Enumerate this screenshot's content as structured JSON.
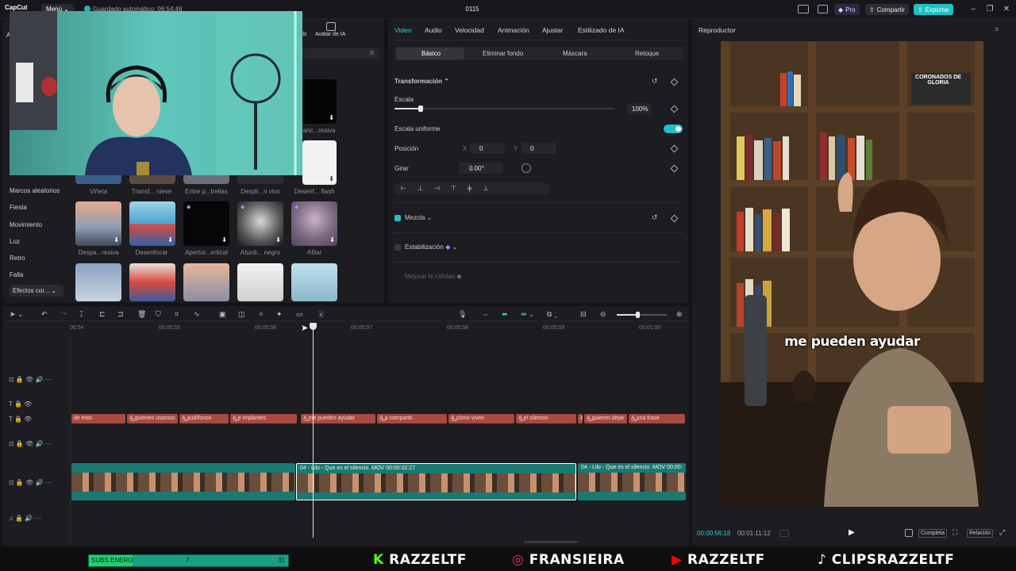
{
  "topbar": {
    "logo": "CapCut",
    "menu": "Menú",
    "autosave": "Guardado automático: 06:54:46",
    "project_title": "0115",
    "pro": "Pro",
    "share": "Compartir",
    "export": "Exportar"
  },
  "left": {
    "tabs": [
      "fils",
      "Avatar de IA"
    ],
    "categories": [
      "Marcos aleatorios",
      "Fiesta",
      "Movimiento",
      "Luz",
      "Retro",
      "Falla",
      "Efectos cor..."
    ],
    "effects_row1": [
      "Viñeta",
      "Transf... nieve",
      "Entre p...trellas",
      "Despli...n vivo",
      "Desenf... flash"
    ],
    "effects_row2": [
      "Despa...resiva",
      "Desenfocar",
      "Apertur...ertical",
      "Aturdi... negro",
      "Afilar"
    ],
    "right_label": "aric...resiva"
  },
  "inspector": {
    "tabs": [
      "Video",
      "Audio",
      "Velocidad",
      "Animación",
      "Ajustar",
      "Estilizado de IA"
    ],
    "subtabs": [
      "Básico",
      "Eliminar fondo",
      "Máscara",
      "Retoque"
    ],
    "transform": "Transformación",
    "scale_label": "Escala",
    "scale_value": "100%",
    "scale_fraction": 0.12,
    "uniform_label": "Escala uniforme",
    "position_label": "Posición",
    "pos_x_label": "X",
    "pos_x": "0",
    "pos_y_label": "Y",
    "pos_y": "0",
    "rotate_label": "Girar",
    "rotate_value": "0.00°",
    "blend": "Mezcla",
    "stabilize": "Estabilización",
    "quality": "Mejorar la calidad"
  },
  "timeline": {
    "ruler": [
      "00:54",
      "00:00:55",
      "00:00:56",
      "00:00:57",
      "00:00:58",
      "00:00:59",
      "00:01:00"
    ],
    "subtitles": [
      "de esto",
      "quienes usamos",
      "audífonos",
      "e implantes",
      "me pueden ayudar",
      "a compartir",
      "cómo viven",
      "el silencio",
      "A",
      "quieren dejar",
      "una frase"
    ],
    "clip_label": "04 - Lilo - Que es el silencio .MOV  00:00:02:27",
    "clip_label_right": "04 - Lilo - Que es el silencio .MOV  00:00:",
    "zoom_fraction": 0.42
  },
  "player": {
    "title": "Reproductor",
    "caption": "me pueden ayudar",
    "current_time": "00:00:56:18",
    "total_time": "00:01:11:12",
    "full_label": "Completa",
    "ratio_label": "Relación",
    "book_title": "CORONADOS DE GLORIA"
  },
  "banner": {
    "subs_label": "SUBS ENERO",
    "subs_current": "7",
    "subs_goal": "31",
    "subs_fraction": 0.22,
    "kick": "RAZZELTF",
    "instagram": "FRANSIEIRA",
    "youtube": "RAZZELTF",
    "tiktok": "CLIPSRAZZELTF"
  }
}
